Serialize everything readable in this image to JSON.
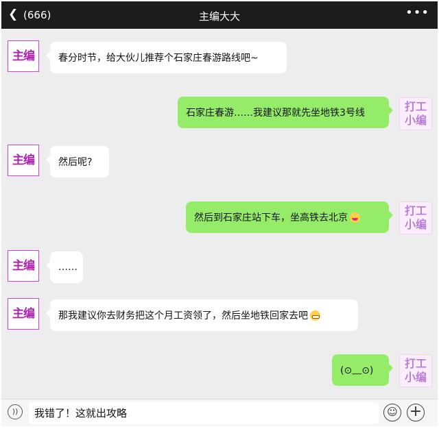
{
  "header": {
    "back_icon": "chevron-left-icon",
    "unread_count": "(666)",
    "title": "主编大大",
    "more_icon": "more-dots-icon"
  },
  "avatars": {
    "left_text": "主编",
    "right_text_line1": "打工",
    "right_text_line2": "小编"
  },
  "colors": {
    "outgoing_bubble": "#95ec69",
    "incoming_bubble": "#ffffff",
    "background": "#ededed",
    "header": "#1c1c1c"
  },
  "messages": [
    {
      "side": "left",
      "text": "春分时节，给大伙儿推荐个石家庄春游路线吧~"
    },
    {
      "side": "right",
      "text": "石家庄春游……我建议那就先坐地铁3号线"
    },
    {
      "side": "left",
      "text": "然后呢?"
    },
    {
      "side": "right",
      "text": "然后到石家庄站下车，坐高铁去北京",
      "emoji": "kissing-face-emoji"
    },
    {
      "side": "left",
      "text": "……"
    },
    {
      "side": "left",
      "text": "那我建议你去财务把这个月工资领了，然后坐地铁回家去吧",
      "emoji": "grimacing-face-emoji"
    },
    {
      "side": "right",
      "text": "(⊙﹏⊙)"
    }
  ],
  "input_bar": {
    "voice_icon": "voice-icon",
    "draft_text": "我错了！这就出攻略",
    "emoji_icon": "emoji-icon",
    "plus_icon": "plus-icon"
  }
}
